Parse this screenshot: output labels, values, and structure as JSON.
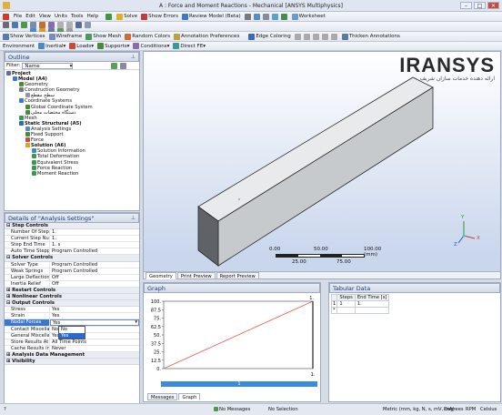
{
  "window": {
    "title": "A : Force and Moment Reactions - Mechanical [ANSYS Multiphysics]",
    "controls": [
      "–",
      "□",
      "✕"
    ]
  },
  "menu": [
    "File",
    "Edit",
    "View",
    "Units",
    "Tools",
    "Help"
  ],
  "toolbar1": {
    "solve": "Solve",
    "show_errors": "Show Errors",
    "review_model": "Review Model (Beta)",
    "worksheet": "Worksheet"
  },
  "toolbar2": {
    "show_vertices": "Show Vertices",
    "wireframe": "Wireframe",
    "show_mesh": "Show Mesh",
    "random_colors": "Random Colors",
    "annotation_prefs": "Annotation Preferences",
    "edge_coloring": "Edge Coloring",
    "thicken_annotations": "Thicken Annotations"
  },
  "toolbar3": {
    "environment": "Environment",
    "inertial": "Inertial",
    "loads": "Loads",
    "supports": "Supports",
    "conditions": "Conditions",
    "direct_fe": "Direct FE"
  },
  "outline": {
    "title": "Outline",
    "filter_label": "Filter:",
    "filter_value": "Name",
    "tree": [
      {
        "label": "Project",
        "depth": 0,
        "bold": true,
        "color": "#5a6fa0"
      },
      {
        "label": "Model (A4)",
        "depth": 1,
        "bold": true,
        "color": "#3c7bc8"
      },
      {
        "label": "Geometry",
        "depth": 2,
        "color": "#4a8a3a"
      },
      {
        "label": "Construction Geometry",
        "depth": 2,
        "color": "#7a7a7a"
      },
      {
        "label": "سطح مقطع",
        "depth": 3,
        "color": "#8a9ab0"
      },
      {
        "label": "Coordinate Systems",
        "depth": 2,
        "color": "#3c7bc8"
      },
      {
        "label": "Global Coordinate System",
        "depth": 3,
        "color": "#4a8a3a"
      },
      {
        "label": "دستگاه مختصات محلی",
        "depth": 3,
        "color": "#4a8a3a"
      },
      {
        "label": "Mesh",
        "depth": 2,
        "color": "#3a9a4a"
      },
      {
        "label": "Static Structural (A5)",
        "depth": 2,
        "bold": true,
        "color": "#2a6ab8"
      },
      {
        "label": "Analysis Settings",
        "depth": 3,
        "color": "#5a8ac8"
      },
      {
        "label": "Fixed Support",
        "depth": 3,
        "color": "#4a8a3a"
      },
      {
        "label": "Force",
        "depth": 3,
        "color": "#c84a3a"
      },
      {
        "label": "Solution (A6)",
        "depth": 3,
        "bold": true,
        "color": "#e0a020"
      },
      {
        "label": "Solution Information",
        "depth": 4,
        "color": "#3a8ac8"
      },
      {
        "label": "Total Deformation",
        "depth": 4,
        "color": "#3a9a4a"
      },
      {
        "label": "Equivalent Stress",
        "depth": 4,
        "color": "#3a9a4a"
      },
      {
        "label": "Force Reaction",
        "depth": 4,
        "color": "#3a9a4a"
      },
      {
        "label": "Moment Reaction",
        "depth": 4,
        "color": "#3a9a4a"
      }
    ]
  },
  "details": {
    "title": "Details of \"Analysis Settings\"",
    "sections": [
      {
        "name": "Step Controls",
        "rows": [
          [
            "Number Of Steps",
            "1."
          ],
          [
            "Current Step Number",
            "1."
          ],
          [
            "Step End Time",
            "1. s"
          ],
          [
            "Auto Time Stepping",
            "Program Controlled"
          ]
        ]
      },
      {
        "name": "Solver Controls",
        "rows": [
          [
            "Solver Type",
            "Program Controlled"
          ],
          [
            "Weak Springs",
            "Program Controlled"
          ],
          [
            "Large Deflection",
            "Off"
          ],
          [
            "Inertia Relief",
            "Off"
          ]
        ]
      },
      {
        "name": "Restart Controls",
        "rows": []
      },
      {
        "name": "Nonlinear Controls",
        "rows": []
      },
      {
        "name": "Output Controls",
        "rows": [
          [
            "Stress",
            "Yes"
          ],
          [
            "Strain",
            "Yes"
          ],
          [
            "Nodal Forces",
            "Yes"
          ],
          [
            "Contact Miscellaneo...",
            "No"
          ],
          [
            "General Miscellaneo...",
            "Yes"
          ],
          [
            "Store Results At",
            "All Time Points"
          ],
          [
            "Cache Results in Me...",
            "Never"
          ]
        ]
      },
      {
        "name": "Analysis Data Management",
        "rows": []
      },
      {
        "name": "Visibility",
        "rows": []
      }
    ],
    "dropdown_options": [
      "No",
      "Yes"
    ]
  },
  "viewport": {
    "logo_text": "IRANSYS",
    "logo_sub": "ارائه دهنده خدمات سازان شریف",
    "scale_ticks": [
      "0.00",
      "50.00",
      "100.00 (mm)"
    ],
    "scale_mid": [
      "25.00",
      "75.00"
    ],
    "tabs": [
      "Geometry",
      "Print Preview",
      "Report Preview"
    ],
    "axes": {
      "x": "X",
      "y": "Y",
      "z": "Z"
    }
  },
  "graph": {
    "title": "Graph",
    "y_ticks": [
      "100.",
      "87.5",
      "75.",
      "62.5",
      "50.",
      "37.5",
      "25.",
      "12.5",
      "0."
    ],
    "x_end": "1.",
    "top_right": "1.",
    "bar_label": "1",
    "tabs": [
      "Messages",
      "Graph"
    ]
  },
  "chart_data": {
    "type": "line",
    "x": [
      0,
      1
    ],
    "series": [
      {
        "values": [
          0,
          100
        ]
      }
    ],
    "ylim": [
      0,
      100
    ],
    "color": "#e05a4a"
  },
  "tabular": {
    "title": "Tabular Data",
    "headers": [
      "Steps",
      "End Time [s]"
    ],
    "rows": [
      [
        "1",
        "1",
        "1."
      ]
    ]
  },
  "status": {
    "messages": "No Messages",
    "selection": "No Selection",
    "units": "Metric (mm, kg, N, s, mV, mA)",
    "degrees": "Degrees",
    "rpm": "RPM",
    "celsius": "Celsius"
  }
}
